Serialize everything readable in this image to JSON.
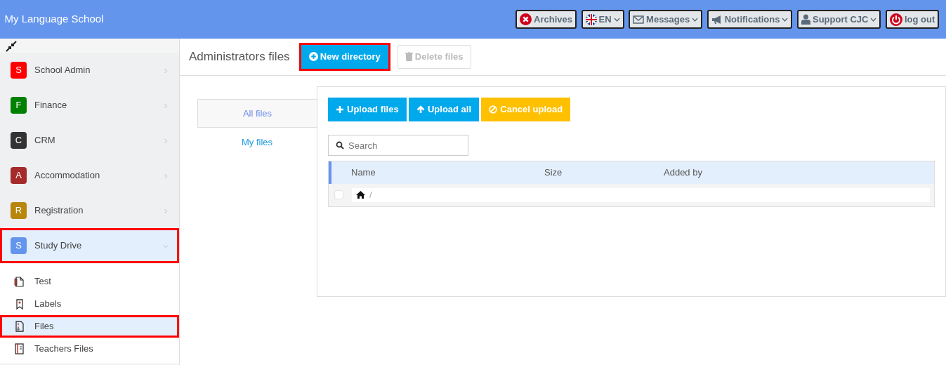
{
  "app_title": "My Language School",
  "top_buttons": [
    {
      "kind": "archives",
      "label": "Archives",
      "dropdown": false
    },
    {
      "kind": "flag",
      "label": "EN",
      "dropdown": true
    },
    {
      "kind": "mail",
      "label": "Messages",
      "dropdown": true
    },
    {
      "kind": "megaphone",
      "label": "Notifications",
      "dropdown": true
    },
    {
      "kind": "user",
      "label": "Support CJC",
      "dropdown": true
    },
    {
      "kind": "power",
      "label": "log out",
      "dropdown": false
    }
  ],
  "sidebar": {
    "items": [
      {
        "letter": "S",
        "label": "School Admin",
        "color": "#ff0000",
        "expanded": false,
        "highlighted": false
      },
      {
        "letter": "F",
        "label": "Finance",
        "color": "#008000",
        "expanded": false,
        "highlighted": false
      },
      {
        "letter": "C",
        "label": "CRM",
        "color": "#333333",
        "expanded": false,
        "highlighted": false
      },
      {
        "letter": "A",
        "label": "Accommodation",
        "color": "#a52a2a",
        "expanded": false,
        "highlighted": false
      },
      {
        "letter": "R",
        "label": "Registration",
        "color": "#b8860b",
        "expanded": false,
        "highlighted": false
      },
      {
        "letter": "S",
        "label": "Study Drive",
        "color": "#6495ed",
        "expanded": true,
        "highlighted": true,
        "children": [
          {
            "kind": "test",
            "label": "Test",
            "selected": false
          },
          {
            "kind": "label",
            "label": "Labels",
            "selected": false
          },
          {
            "kind": "file",
            "label": "Files",
            "selected": true
          },
          {
            "kind": "book",
            "label": "Teachers Files",
            "selected": false
          }
        ]
      }
    ]
  },
  "header": {
    "title": "Administrators files",
    "new_button": {
      "label": "New directory",
      "highlighted": true
    },
    "delete_button": {
      "label": "Delete files",
      "disabled": true
    }
  },
  "file_tabs": [
    {
      "label": "All files",
      "selected": true
    },
    {
      "label": "My files",
      "selected": false
    }
  ],
  "upload_buttons": [
    {
      "kind": "plus",
      "label": "Upload files"
    },
    {
      "kind": "up",
      "label": "Upload all"
    },
    {
      "kind": "cancel",
      "label": "Cancel upload"
    }
  ],
  "search": {
    "placeholder": "Search"
  },
  "table": {
    "columns": [
      "Name",
      "Size",
      "Added by"
    ],
    "rows": [
      {
        "path": "/",
        "checked": false
      }
    ]
  }
}
